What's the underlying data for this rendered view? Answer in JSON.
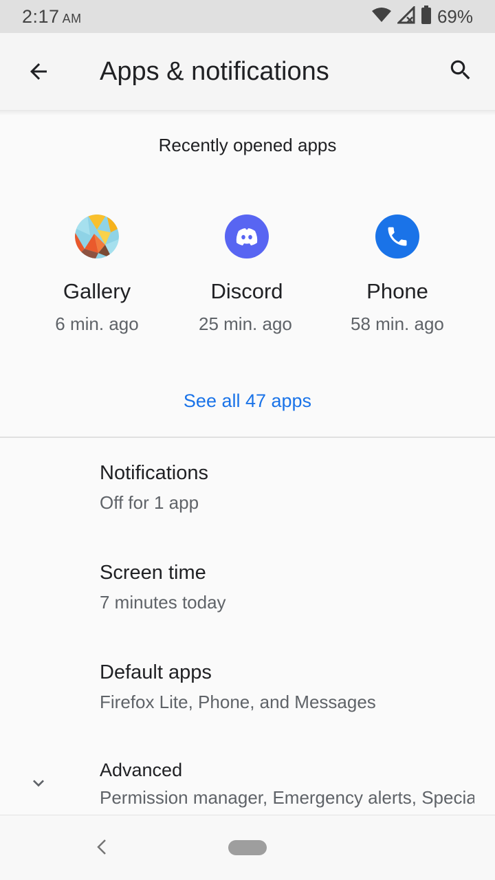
{
  "status_bar": {
    "time": "2:17",
    "meridiem": "AM",
    "battery": "69%",
    "icons": [
      "wifi-icon",
      "signal-icon",
      "battery-icon"
    ]
  },
  "app_bar": {
    "title": "Apps & notifications",
    "back_icon": "arrow-back-icon",
    "search_icon": "search-icon"
  },
  "recent": {
    "header": "Recently opened apps",
    "apps": [
      {
        "name": "Gallery",
        "time": "6 min. ago",
        "icon": "gallery-icon"
      },
      {
        "name": "Discord",
        "time": "25 min. ago",
        "icon": "discord-icon"
      },
      {
        "name": "Phone",
        "time": "58 min. ago",
        "icon": "phone-icon"
      }
    ],
    "see_all": "See all 47 apps"
  },
  "list": [
    {
      "title": "Notifications",
      "summary": "Off for 1 app"
    },
    {
      "title": "Screen time",
      "summary": "7 minutes today"
    },
    {
      "title": "Default apps",
      "summary": "Firefox Lite, Phone, and Messages"
    },
    {
      "title": "Advanced",
      "summary": "Permission manager, Emergency alerts, Special app access",
      "icon": "chevron-down-icon"
    }
  ],
  "colors": {
    "accent": "#1a73e8",
    "discord": "#5865f2",
    "phone": "#1a73e8"
  }
}
